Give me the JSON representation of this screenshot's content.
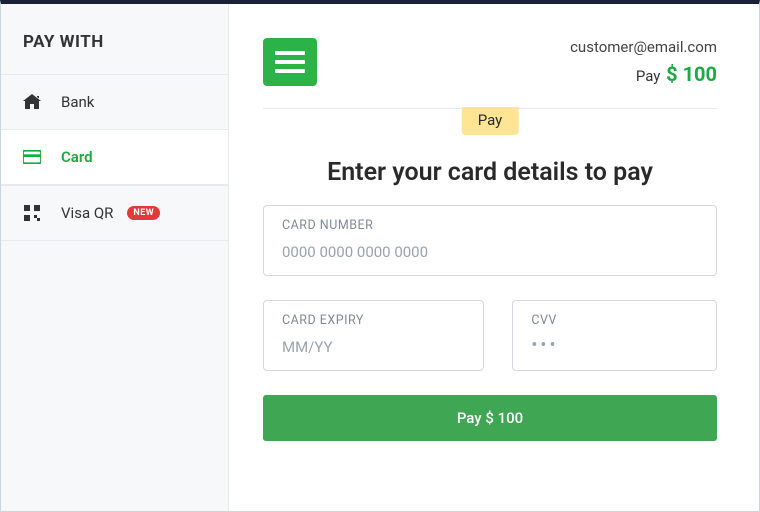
{
  "sidebar": {
    "title": "PAY WITH",
    "items": [
      {
        "label": "Bank"
      },
      {
        "label": "Card"
      },
      {
        "label": "Visa QR",
        "badge": "NEW"
      }
    ]
  },
  "header": {
    "email": "customer@email.com",
    "pay_prefix": "Pay",
    "amount": "$ 100"
  },
  "tab": {
    "label": "Pay"
  },
  "form": {
    "heading": "Enter your card details to pay",
    "card_number": {
      "label": "CARD NUMBER",
      "placeholder": "0000 0000 0000 0000"
    },
    "expiry": {
      "label": "CARD EXPIRY",
      "placeholder": "MM/YY"
    },
    "cvv": {
      "label": "CVV",
      "placeholder": "•••"
    },
    "button": "Pay $ 100"
  },
  "colors": {
    "accent": "#1aaa41",
    "button": "#3fa654"
  }
}
